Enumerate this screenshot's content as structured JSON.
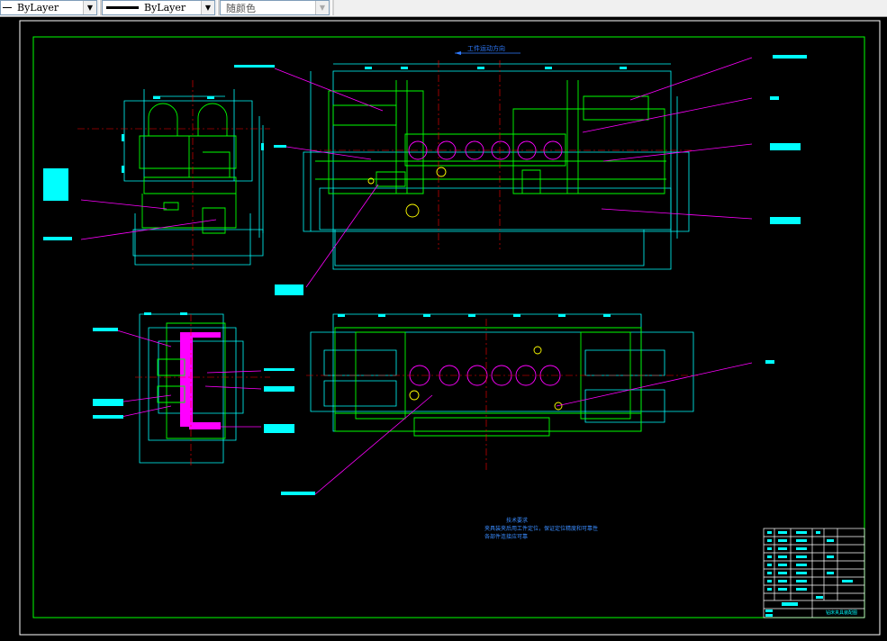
{
  "toolbar": {
    "linetype_combo": {
      "value": "ByLayer"
    },
    "lineweight_combo": {
      "value": "ByLayer"
    },
    "plotstyle_combo": {
      "value": "随颜色"
    }
  },
  "drawing": {
    "direction_note": "工件运动方向",
    "tech_requirements": [
      "技术要求",
      "夹具装夹后用工件定位，保证定位精度和可靠性",
      "各部件连接应可靠"
    ],
    "title_block_name": "钻床夹具装配图"
  },
  "colors": {
    "background": "#000000",
    "border": "#00ff00",
    "dimension": "#00ffff",
    "leader": "#ff00ff",
    "center_line": "#ff0000",
    "part_outline": "#00ff00",
    "hatch": "#ff00ff",
    "tag_fill": "#00ffff"
  }
}
